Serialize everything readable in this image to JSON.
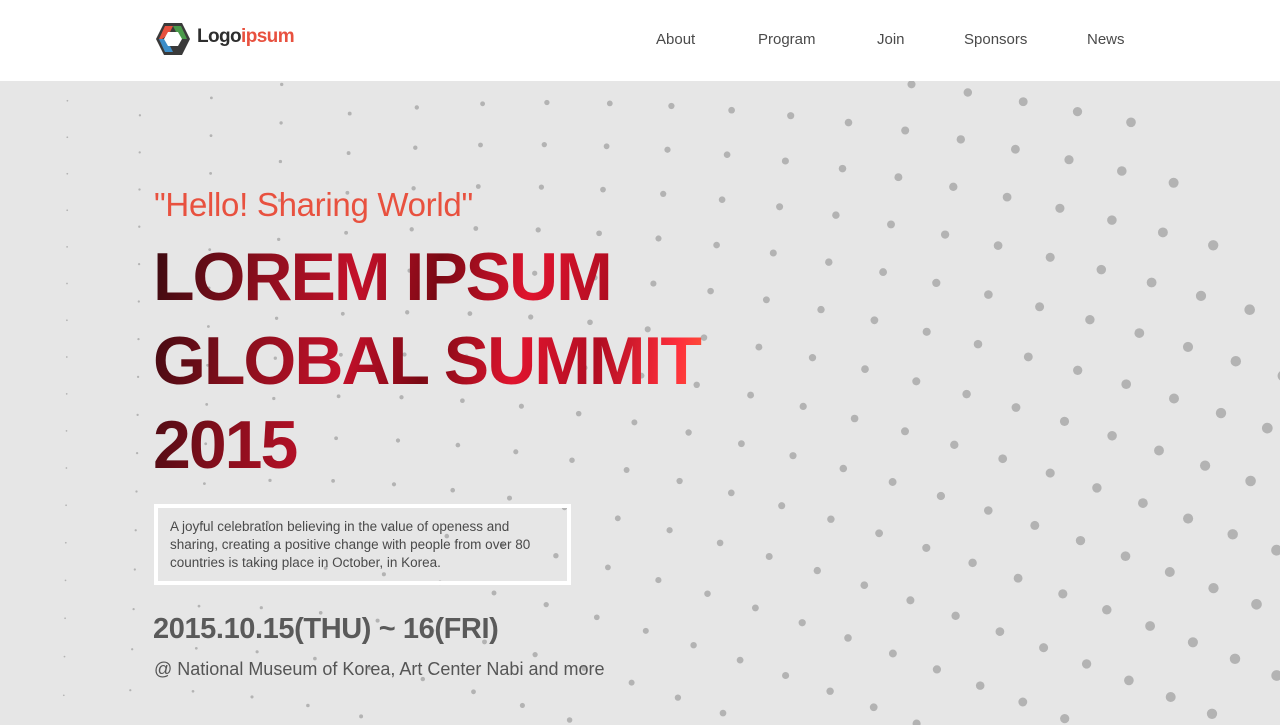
{
  "header": {
    "logo": {
      "text_dark": "Logo",
      "text_accent": "ipsum",
      "icon": "hexagon-logo-icon"
    },
    "nav": [
      "About",
      "Program",
      "Join",
      "Sponsors",
      "News"
    ]
  },
  "hero": {
    "tagline": "\"Hello! Sharing World\"",
    "title_lines": [
      "LOREM IPSUM",
      "GLOBAL SUMMIT",
      "2015"
    ],
    "description": "A joyful celebration believing in the value of openess and sharing, creating a positive change with people from over 80 countries is taking place in October, in Korea.",
    "date": "2015.10.15(THU) ~ 16(FRI)",
    "venue": "@ National Museum of Korea, Art Center Nabi and more"
  },
  "colors": {
    "accent": "#e8513f",
    "background": "#e6e6e6",
    "header_bg": "#ffffff",
    "nav_text": "#4a4a4a",
    "dot": "#b3b3b3"
  }
}
